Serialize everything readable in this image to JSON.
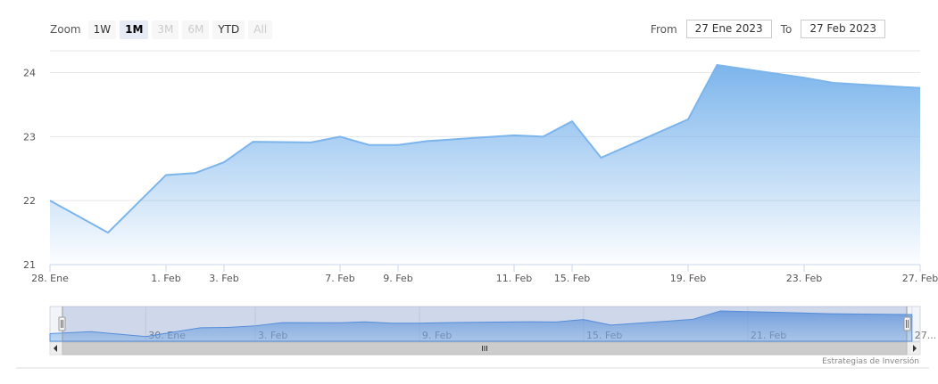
{
  "toolbar": {
    "zoom_label": "Zoom",
    "zoom_buttons": [
      {
        "label": "1W",
        "state": "normal"
      },
      {
        "label": "1M",
        "state": "active"
      },
      {
        "label": "3M",
        "state": "disabled"
      },
      {
        "label": "6M",
        "state": "disabled"
      },
      {
        "label": "YTD",
        "state": "normal"
      },
      {
        "label": "All",
        "state": "disabled"
      }
    ],
    "from_label": "From",
    "from_value": "27 Ene 2023",
    "to_label": "To",
    "to_value": "27 Feb 2023"
  },
  "chart_data": {
    "type": "area",
    "x": [
      "2023-01-28",
      "2023-01-30",
      "2023-02-01",
      "2023-02-02",
      "2023-02-03",
      "2023-02-04",
      "2023-02-06",
      "2023-02-07",
      "2023-02-08",
      "2023-02-09",
      "2023-02-10",
      "2023-02-13",
      "2023-02-14",
      "2023-02-15",
      "2023-02-16",
      "2023-02-19",
      "2023-02-20",
      "2023-02-23",
      "2023-02-24",
      "2023-02-27"
    ],
    "series": [
      {
        "values": [
          22.0,
          21.5,
          22.4,
          22.43,
          22.6,
          22.92,
          22.91,
          23.0,
          22.87,
          22.87,
          22.93,
          23.02,
          23.0,
          23.24,
          22.67,
          23.27,
          24.12,
          23.92,
          23.84,
          23.76
        ]
      }
    ],
    "x_ticks": [
      {
        "date": "2023-01-28",
        "label": "28. Ene"
      },
      {
        "date": "2023-02-01",
        "label": "1. Feb"
      },
      {
        "date": "2023-02-03",
        "label": "3. Feb"
      },
      {
        "date": "2023-02-07",
        "label": "7. Feb"
      },
      {
        "date": "2023-02-09",
        "label": "9. Feb"
      },
      {
        "date": "2023-02-13",
        "label": "11. Feb"
      },
      {
        "date": "2023-02-15",
        "label": "15. Feb"
      },
      {
        "date": "2023-02-19",
        "label": "19. Feb"
      },
      {
        "date": "2023-02-23",
        "label": "23. Feb"
      },
      {
        "date": "2023-02-27",
        "label": "27. Feb"
      }
    ],
    "y_ticks": [
      21,
      22,
      23,
      24
    ],
    "ylim": [
      21,
      24.3
    ],
    "grid": true,
    "color": "#7cb5ec",
    "navigator_labels": [
      "30. Ene",
      "3. Feb",
      "9. Feb",
      "15. Feb",
      "21. Feb",
      "27..."
    ],
    "credit": "Estrategias de Inversión"
  }
}
